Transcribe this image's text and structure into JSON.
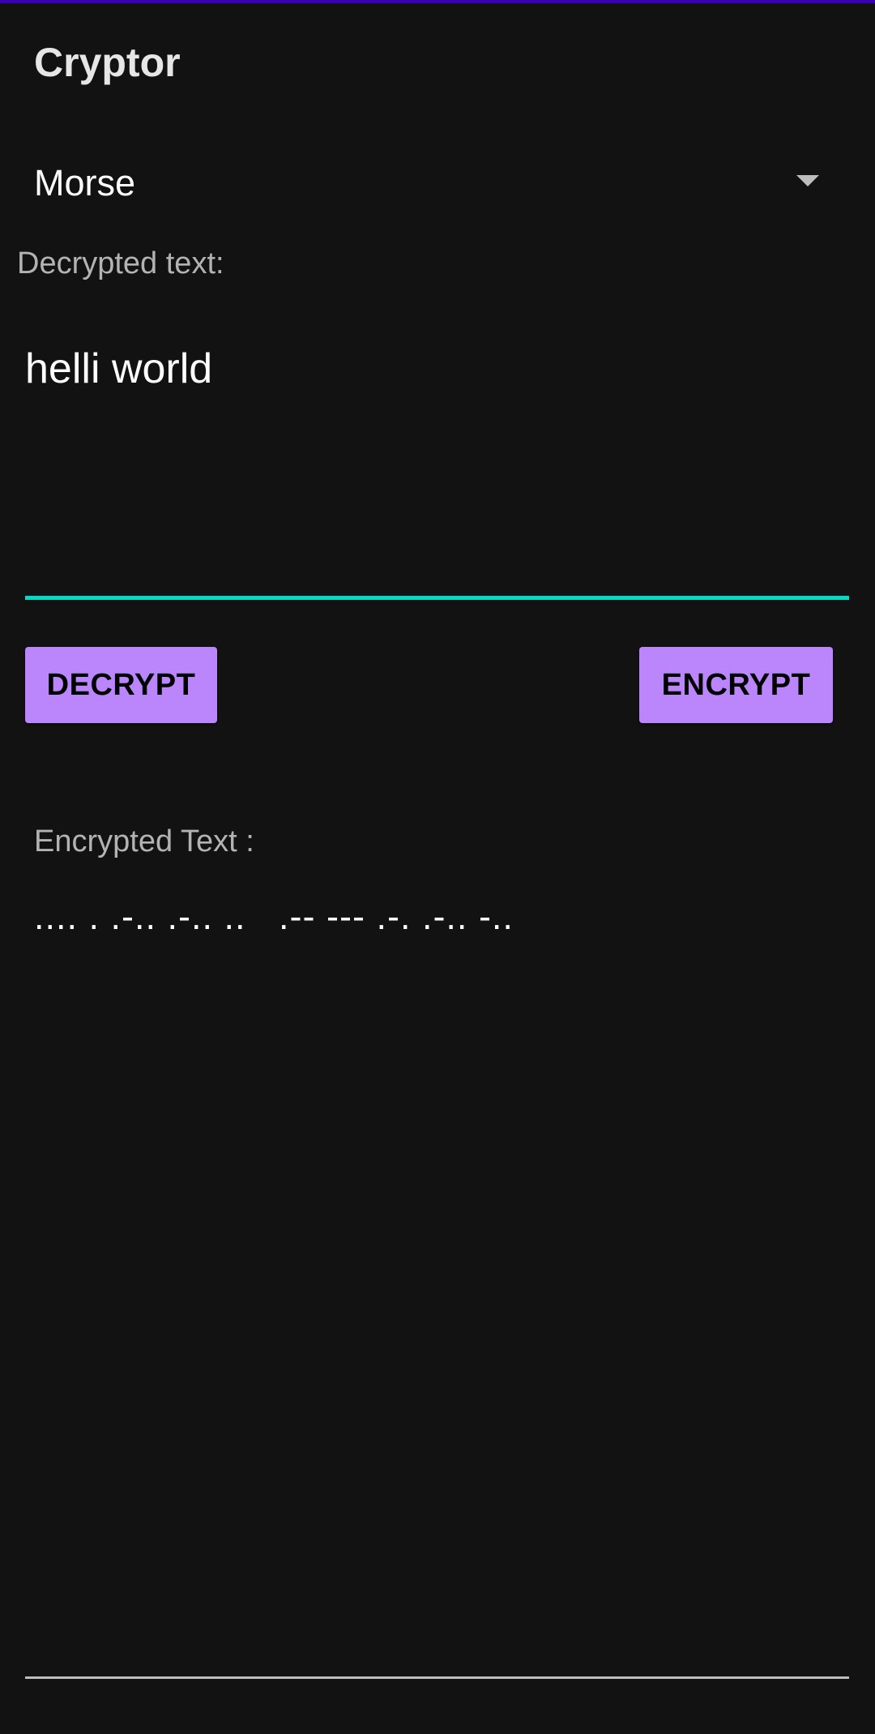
{
  "app": {
    "title": "Cryptor"
  },
  "cipher_select": {
    "selected": "Morse"
  },
  "decrypted": {
    "label": "Decrypted text:",
    "value": "helli world"
  },
  "buttons": {
    "decrypt_label": "DECRYPT",
    "encrypt_label": "ENCRYPT"
  },
  "encrypted": {
    "label": "Encrypted Text :",
    "value": ".... . .-.. .-.. ..   .-- --- .-. .-.. -.."
  },
  "colors": {
    "background": "#121212",
    "accent_top": "#3700b3",
    "button": "#bb86fc",
    "underline_active": "#03dac5"
  }
}
